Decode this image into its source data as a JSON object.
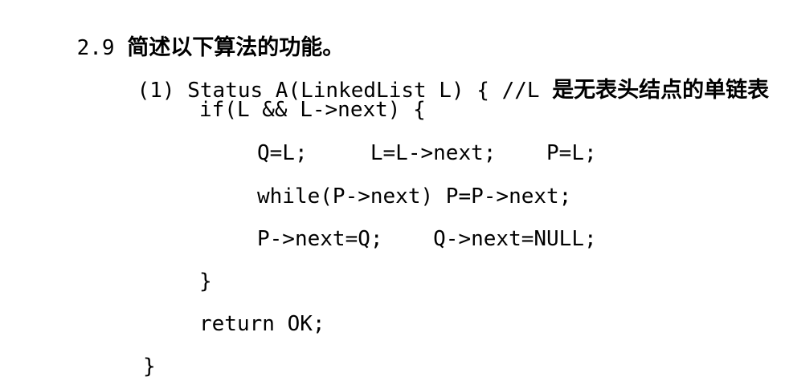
{
  "question": {
    "number": "2.9",
    "title": "简述以下算法的功能。"
  },
  "code": {
    "signature_prefix": "(1) Status A(LinkedList L) { //L ",
    "signature_comment": "是无表头结点的单链表",
    "if_line": "if(L && L->next) {",
    "assign_line": "Q=L;     L=L->next;    P=L;",
    "while_line": "while(P->next) P=P->next;",
    "link_line": "P->next=Q;    Q->next=NULL;",
    "close_if": "}",
    "return_line": "return OK;",
    "close_func": "}"
  }
}
